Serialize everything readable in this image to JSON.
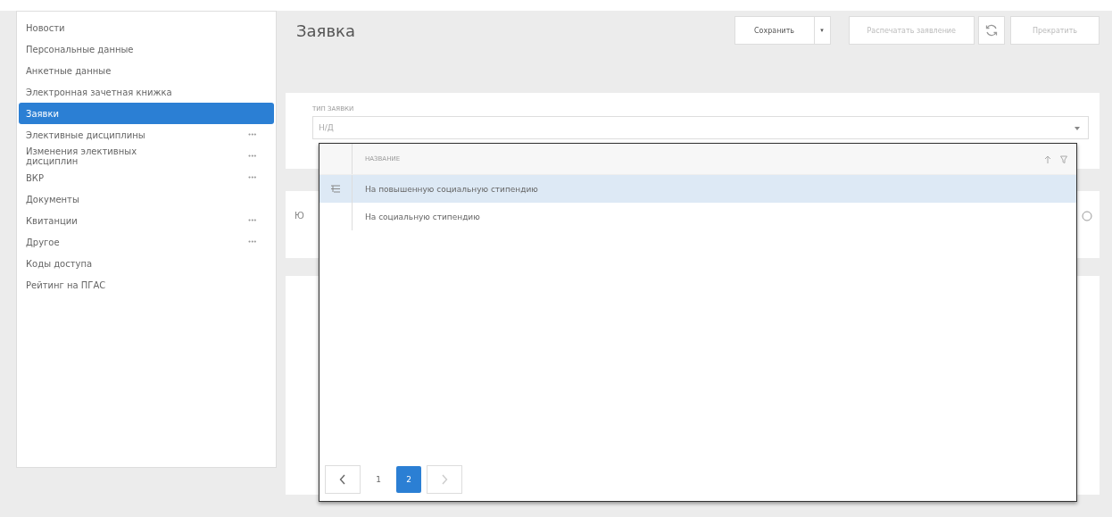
{
  "sidebar": {
    "items": [
      {
        "label": "Новости",
        "selected": false
      },
      {
        "label": "Персональные данные",
        "selected": false
      },
      {
        "label": "Анкетные данные",
        "selected": false
      },
      {
        "label": "Электронная зачетная книжка",
        "selected": false
      },
      {
        "label": "Заявки",
        "selected": true
      },
      {
        "label": "Элективные дисциплины",
        "selected": false,
        "more": "•••"
      },
      {
        "label": "Изменения элективных дисциплин",
        "selected": false,
        "more": "•••"
      },
      {
        "label": "ВКР",
        "selected": false,
        "more": "•••"
      },
      {
        "label": "Документы",
        "selected": false
      },
      {
        "label": "Квитанции",
        "selected": false,
        "more": "•••"
      },
      {
        "label": "Другое",
        "selected": false,
        "more": "•••"
      },
      {
        "label": "Коды доступа",
        "selected": false
      },
      {
        "label": "Рейтинг на ПГАС",
        "selected": false
      }
    ]
  },
  "header": {
    "title": "Заявка",
    "buttons": [
      {
        "kind": "split",
        "label": "Сохранить",
        "caret": "▾",
        "disabled": false
      },
      {
        "kind": "text",
        "label": "Распечатать заявление",
        "disabled": true
      },
      {
        "kind": "icon",
        "disabled": false
      },
      {
        "kind": "text",
        "label": "Прекратить",
        "disabled": true
      }
    ]
  },
  "form": {
    "field": {
      "label": "ТИП ЗАЯВКИ",
      "value": "Н/Д"
    }
  },
  "second_card": {
    "text": "Ю"
  },
  "dropdown": {
    "columns": [
      {
        "label": "НАЗВАНИЕ"
      }
    ],
    "rows": [
      {
        "name": "На повышенную социальную стипендию",
        "selected": true
      },
      {
        "name": "На социальную стипендию",
        "selected": false
      }
    ],
    "pagination": {
      "prev_disabled": false,
      "next_disabled": true,
      "pages": [
        {
          "label": "1",
          "selected": false
        },
        {
          "label": "2",
          "selected": true
        }
      ]
    }
  }
}
